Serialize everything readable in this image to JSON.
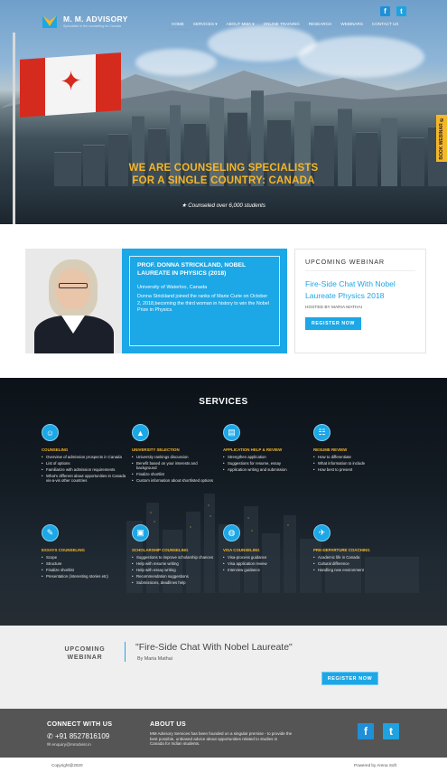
{
  "brand": {
    "name": "M. M. ADVISORY",
    "tagline": "Specialists in the counseling for Canada"
  },
  "nav": {
    "items": [
      "HOME",
      "SERVICES ▾",
      "ABOUT MMA ▾",
      "ONLINE TRAINING",
      "RESEARCH",
      "WEBINARS",
      "CONTACT US"
    ],
    "active_index": 0
  },
  "social": {
    "facebook": "f",
    "twitter": "t"
  },
  "hero": {
    "headline_line1": "WE ARE COUNSELING SPECIALISTS",
    "headline_line2": "FOR A SINGLE COUNTRY: CANADA",
    "subtext": "★ Counseled over 6,000 students",
    "book_tab": "BOOK WEBINAR ✆"
  },
  "profile": {
    "title": "PROF. DONNA STRICKLAND, NOBEL LAUREATE IN PHYSICS (2018)",
    "university": "University of Waterloo, Canada",
    "description": "Donna Strickland joined the ranks of Marie Curie on October 2, 2018,becoming the third woman in history to win the Nobel Prize in Physics."
  },
  "webinar_card": {
    "heading": "UPCOMING WEBINAR",
    "title": "Fire-Side Chat With Nobel Laureate Physics 2018",
    "host": "HOSTED BY MARIA MATHAI",
    "button": "REGISTER NOW"
  },
  "services": {
    "title": "SERVICES",
    "items": [
      {
        "name": "COUNSELING",
        "icon": "user-icon",
        "points": [
          "Overview of admission prospects in Canada",
          "List of options",
          "Familiarize with admission requirements",
          "What's different about opportunities in Canada vis-a-vis other countries"
        ]
      },
      {
        "name": "UNIVERSITY SELECTION",
        "icon": "graduation-cap-icon",
        "points": [
          "University rankings discussion",
          "Benefit based on your interests and background",
          "Finalize shortlist",
          "Custom information about shortlisted options"
        ]
      },
      {
        "name": "APPLICATION HELP & REVIEW",
        "icon": "document-icon",
        "points": [
          "Strengthen application",
          "Suggestions for resume, essay",
          "Application writing and submission"
        ]
      },
      {
        "name": "RESUME REVIEW",
        "icon": "resume-icon",
        "points": [
          "How to differentiate",
          "What information to include",
          "How best to present"
        ]
      },
      {
        "name": "ESSAYS COUNSELING",
        "icon": "pencil-icon",
        "points": [
          "Scope",
          "Structure",
          "Finalize shortlist",
          "Presentation (interesting stories etc)"
        ]
      },
      {
        "name": "SCHOLARSHIP COUNSELING",
        "icon": "certificate-icon",
        "points": [
          "Suggestions to improve scholarship chances",
          "Help with resume writing",
          "Help with essay writing",
          "Recommendation suggestions",
          "Submissions, deadlines help"
        ]
      },
      {
        "name": "VISA COUNSELING",
        "icon": "globe-icon",
        "points": [
          "Visa-process guidance",
          "Visa application review",
          "Interview guidance"
        ]
      },
      {
        "name": "PRE-DEPARTURE COACHING",
        "icon": "airplane-icon",
        "points": [
          "Academic life in Canada",
          "Cultural difference",
          "Handling new environment"
        ]
      }
    ]
  },
  "upcoming": {
    "label_line1": "UPCOMING",
    "label_line2": "WEBINAR",
    "title": "\"Fire-Side Chat With Nobel Laureate\"",
    "host": "By Maria Mathai",
    "button": "REGISTER NOW"
  },
  "footer": {
    "connect_heading": "CONNECT WITH US",
    "phone": "+91 8527816109",
    "email": "enquiry@mmdvisr.in",
    "about_heading": "ABOUT US",
    "about_text": "MM Advisory Services has been founded on a singular premise - to provide the best possible, unbiased advice about opportunities related to studies in Canada for Indian students.",
    "copyright": "Copyright@2020",
    "powered": "Powered by Arena Soft"
  },
  "colors": {
    "accent": "#1ca7e6",
    "gold": "#f5b628",
    "dark": "#555555"
  }
}
